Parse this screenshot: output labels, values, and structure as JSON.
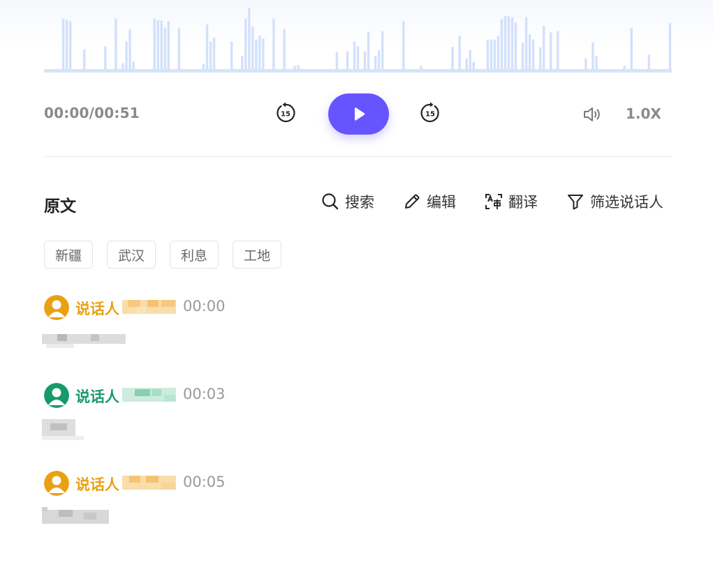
{
  "player": {
    "waveform": [
      0,
      0,
      0,
      0,
      0,
      78,
      76,
      74,
      0,
      0,
      0,
      31,
      0,
      0,
      0,
      0,
      0,
      36,
      0,
      0,
      78,
      0,
      10,
      43,
      62,
      13,
      0,
      0,
      0,
      0,
      0,
      78,
      76,
      75,
      64,
      74,
      0,
      0,
      64,
      0,
      0,
      0,
      0,
      0,
      0,
      9,
      69,
      43,
      49,
      0,
      0,
      0,
      0,
      43,
      0,
      0,
      21,
      78,
      94,
      66,
      46,
      52,
      48,
      0,
      0,
      78,
      0,
      0,
      62,
      0,
      0,
      6,
      7,
      0,
      0,
      0,
      0,
      0,
      0,
      0,
      0,
      0,
      0,
      27,
      0,
      0,
      28,
      0,
      43,
      36,
      0,
      28,
      58,
      0,
      21,
      30,
      59,
      0,
      0,
      0,
      0,
      0,
      74,
      0,
      0,
      0,
      0,
      6,
      0,
      0,
      0,
      0,
      0,
      0,
      0,
      0,
      35,
      0,
      52,
      0,
      17,
      30,
      12,
      0,
      0,
      0,
      46,
      46,
      46,
      52,
      77,
      82,
      82,
      80,
      72,
      0,
      41,
      80,
      54,
      46,
      0,
      34,
      67,
      0,
      57,
      0,
      59,
      0,
      0,
      0,
      0,
      0,
      0,
      0,
      17,
      0,
      42,
      21,
      0,
      0,
      0,
      0,
      0,
      0,
      0,
      6,
      0,
      64,
      0,
      0,
      0,
      0,
      23,
      0,
      0,
      0,
      0,
      0,
      71
    ],
    "time_display": "00:00/00:51",
    "skip_seconds": "15",
    "speed_label": "1.0X",
    "accent_color": "#6655ff"
  },
  "transcript": {
    "title": "原文",
    "tools": [
      {
        "label": "搜索",
        "icon": "search-icon"
      },
      {
        "label": "编辑",
        "icon": "pencil-icon"
      },
      {
        "label": "翻译",
        "icon": "translate-icon"
      },
      {
        "label": "筛选说话人",
        "icon": "filter-icon"
      }
    ],
    "keywords": [
      "新疆",
      "武汉",
      "利息",
      "工地"
    ],
    "entries": [
      {
        "speaker": "说话人",
        "timestamp": "00:00",
        "color": "#e9a013"
      },
      {
        "speaker": "说话人",
        "timestamp": "00:03",
        "color": "#179a6a"
      },
      {
        "speaker": "说话人",
        "timestamp": "00:05",
        "color": "#e9a013"
      }
    ]
  }
}
